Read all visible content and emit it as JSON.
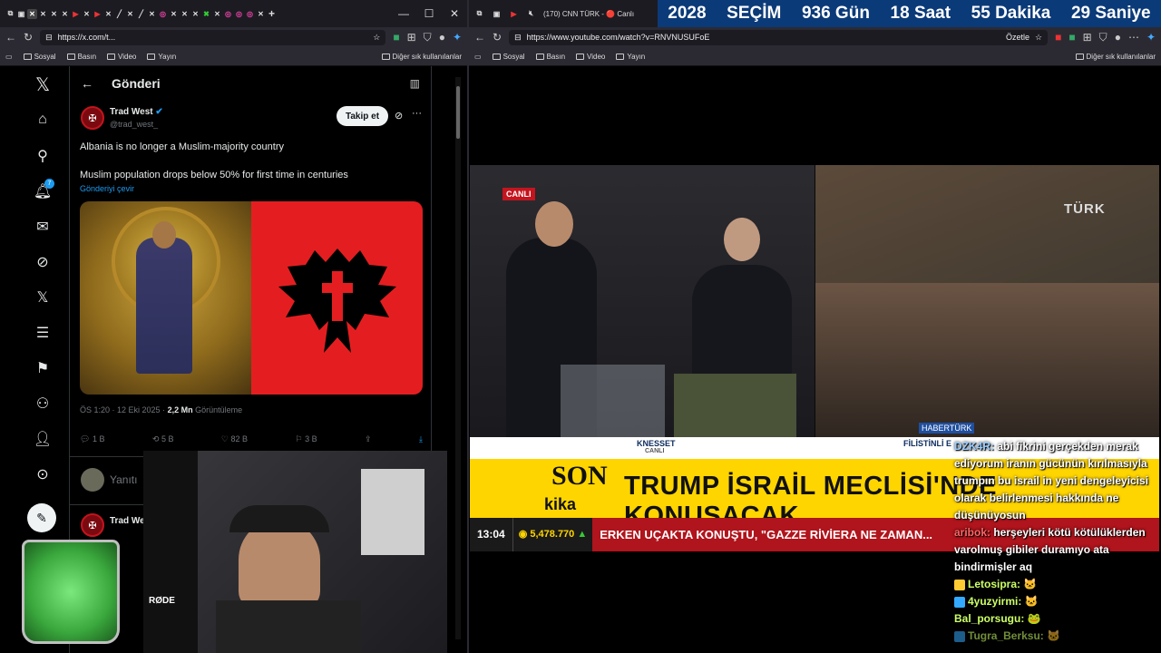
{
  "left_browser": {
    "url": "https://x.com/t...",
    "bookmarks": [
      "Sosyal",
      "Basın",
      "Video",
      "Yayın"
    ],
    "other_bookmarks": "Diğer sık kullanılanlar"
  },
  "right_browser": {
    "tab_title": "(170) CNN TÜRK - 🔴 Canlı",
    "url": "https://www.youtube.com/watch?v=RNVNUSUFoE",
    "summarize": "Özetle",
    "bookmarks": [
      "Sosyal",
      "Basın",
      "Video",
      "Yayın"
    ],
    "other_bookmarks": "Diğer sık kullanılanlar"
  },
  "countdown": {
    "year": "2028",
    "label": "SEÇİM",
    "days": "936 Gün",
    "hours": "18 Saat",
    "minutes": "55 Dakika",
    "seconds": "29 Saniye"
  },
  "x": {
    "header_title": "Gönderi",
    "notif_badge": "7",
    "author_name": "Trad West",
    "author_handle": "@trad_west_",
    "follow_label": "Takip et",
    "line1": "Albania is no longer a Muslim-majority country",
    "line2": "Muslim population drops below 50% for first time in centuries",
    "translate": "Gönderiyi çevir",
    "meta_time": "ÖS 1:20 · 12 Eki 2025 · ",
    "meta_views": "2,2 Mn",
    "meta_views_label": " Görüntüleme",
    "replies": "1 B",
    "reposts": "5 B",
    "likes": "82 B",
    "bookmarks": "3 B",
    "reply_placeholder": "Yanıtı",
    "next_author": "Trad We"
  },
  "video": {
    "live": "CANLI",
    "channel": "TÜRK",
    "knesset": "KNESSET",
    "knesset_sub": "CANLI",
    "filistin": "FİLİSTİNLİ E",
    "son": "SON",
    "dakika": "kika",
    "headline": "TRUMP İSRAİL MECLİSİ'NDE KONUŞACAK",
    "clock": "13:04",
    "stock": "5,478.770",
    "ticker": "ERKEN UÇAKTA KONUŞTU, \"GAZZE RİVİERA NE ZAMAN...",
    "habert": "HABERTÜRK"
  },
  "chat": [
    {
      "user": "DZK4R:",
      "text": " abi fikrini gerçekden merak ediyorum iranın gücünün kırılmasıyla trumpın bu israil in yeni dengeleyicisi olarak belirlenmesi hakkında ne düşünüyosun"
    },
    {
      "user": "aribok:",
      "text": " herşeyleri kötü kötülüklerden varolmuş gibiler duramıyo ata bindirmişler aq"
    },
    {
      "user": "Letosipra:",
      "text": " 🐱"
    },
    {
      "user": "4yuzyirmi:",
      "text": " 🐱"
    },
    {
      "user": "Bal_porsugu:",
      "text": " 🐸"
    },
    {
      "user": "Tugra_Berksu:",
      "text": " 🐱"
    }
  ],
  "colors": {
    "x_blue": "#1d9bf0",
    "flag_red": "#e41e20",
    "ticker_yellow": "#ffd500",
    "countdown_blue": "#0b3a78"
  }
}
